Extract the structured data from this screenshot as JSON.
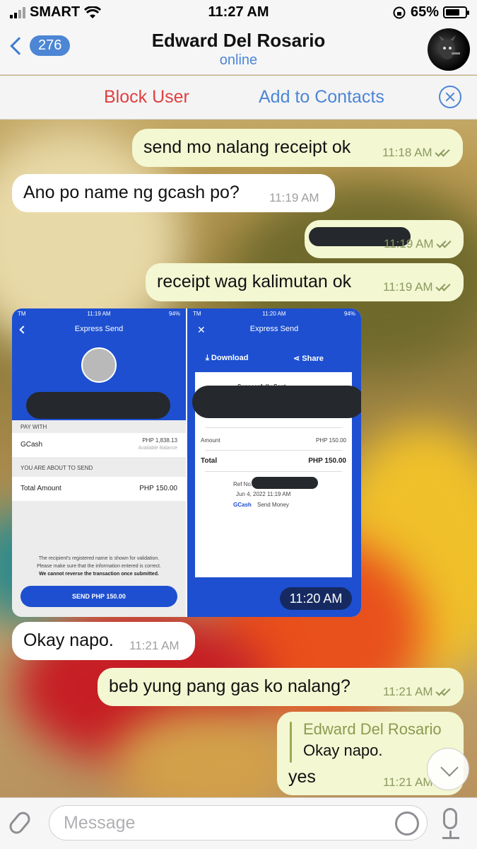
{
  "status_bar": {
    "carrier": "SMART",
    "time": "11:27 AM",
    "battery": "65%"
  },
  "header": {
    "back_count": "276",
    "contact_name": "Edward Del Rosario",
    "status": "online"
  },
  "action_bar": {
    "block_label": "Block User",
    "add_contact_label": "Add to Contacts"
  },
  "messages": [
    {
      "direction": "out",
      "text": "send mo nalang receipt ok",
      "time": "11:18 AM",
      "read": true
    },
    {
      "direction": "in",
      "text": "Ano po name ng gcash po?",
      "time": "11:19 AM"
    },
    {
      "direction": "out",
      "text": "",
      "time": "11:19 AM",
      "read": true,
      "redacted": true
    },
    {
      "direction": "out",
      "text": "receipt wag kalimutan ok",
      "time": "11:19 AM",
      "read": true
    },
    {
      "direction": "in",
      "type": "image",
      "time": "11:20 AM"
    },
    {
      "direction": "in",
      "text": "Okay napo.",
      "time": "11:21 AM"
    },
    {
      "direction": "out",
      "text": "beb yung pang gas ko nalang?",
      "time": "11:21 AM",
      "read": true
    },
    {
      "direction": "out",
      "text": "yes",
      "time": "11:21 AM",
      "read": true,
      "reply_to": {
        "name": "Edward Del Rosario",
        "text": "Okay napo."
      }
    }
  ],
  "image_left": {
    "status_time": "11:19 AM",
    "status_carrier": "TM",
    "status_battery": "94%",
    "title": "Express Send",
    "pay_with_label": "PAY WITH",
    "source": "GCash",
    "balance": "PHP 1,838.13",
    "balance_label": "Available Balance",
    "about_label": "YOU ARE ABOUT TO SEND",
    "total_label": "Total Amount",
    "total_value": "PHP 150.00",
    "note1": "The recipient's registered name is shown for validation.",
    "note2": "Please make sure that the information entered is correct.",
    "note3": "We cannot reverse the transaction once submitted.",
    "send_button": "SEND PHP 150.00"
  },
  "image_right": {
    "status_time": "11:20 AM",
    "status_carrier": "TM",
    "status_battery": "94%",
    "title": "Express Send",
    "download": "Download",
    "share": "Share",
    "success": "Successfully Sent",
    "amount_label": "Amount",
    "amount_value": "PHP 150.00",
    "total_label": "Total",
    "total_value": "PHP 150.00",
    "ref_label": "Ref No.",
    "date": "Jun 4, 2022 11:19 AM",
    "brand": "GCash",
    "brand_suffix": "Send Money"
  },
  "input": {
    "placeholder": "Message"
  },
  "colors": {
    "accent": "#4c86d4",
    "danger": "#e04040",
    "outgoing_bubble": "#f3f7d2",
    "gcash_blue": "#1d4fd0"
  }
}
